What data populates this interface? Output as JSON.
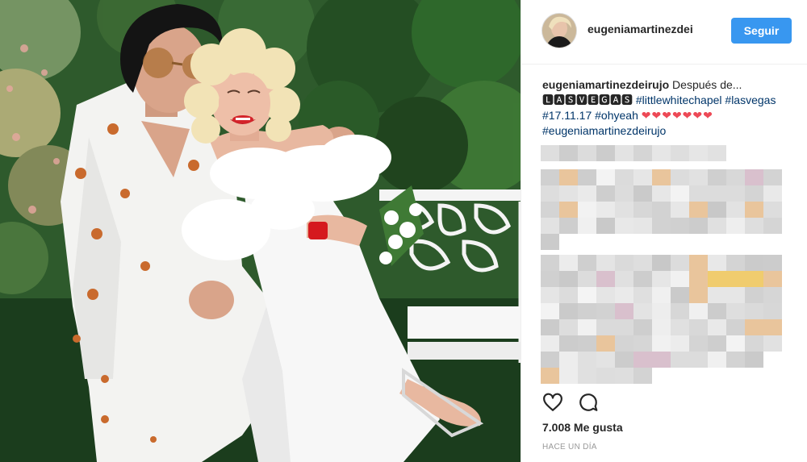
{
  "post": {
    "username": "eugeniamartinezdei",
    "follow_label": "Seguir",
    "caption_user": "eugeniamartinezdeirujo",
    "caption_text_1": " Después de...",
    "caption_glyphs": "🅻🅰🆂🆅🅴🅶🅰🆂",
    "tag_chapel": "#littlewhitechapel",
    "tag_vegas": "#lasvegas",
    "tag_date": "#17.11.17",
    "tag_ohyeah": "#ohyeah",
    "hearts": "❤❤❤❤❤❤❤",
    "tag_user": "#eugeniamartinezdeirujo",
    "likes": "7.008 Me gusta",
    "time_ago": "HACE UN DÍA"
  },
  "icons": {
    "like": "heart-outline-icon",
    "comment": "comment-bubble-icon"
  },
  "colors": {
    "follow_button": "#3897f0",
    "hashtag": "#003569",
    "heart": "#ed4956",
    "timestamp": "#999999"
  }
}
